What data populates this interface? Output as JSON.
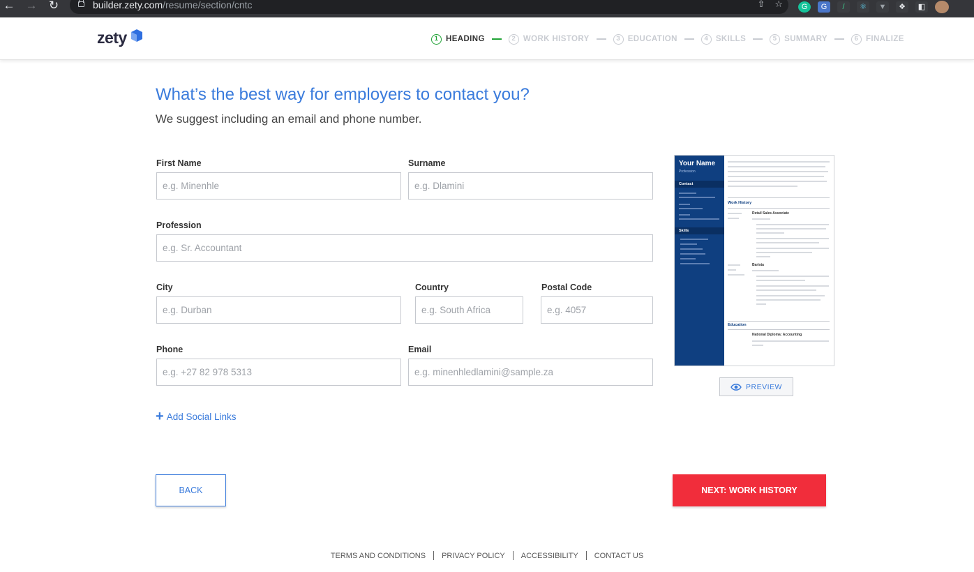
{
  "browser": {
    "url_host": "builder.zety.com",
    "url_path": "/resume/section/cntc"
  },
  "header": {
    "logo": "zety",
    "steps": [
      {
        "num": "1",
        "label": "HEADING"
      },
      {
        "num": "2",
        "label": "WORK HISTORY"
      },
      {
        "num": "3",
        "label": "EDUCATION"
      },
      {
        "num": "4",
        "label": "SKILLS"
      },
      {
        "num": "5",
        "label": "SUMMARY"
      },
      {
        "num": "6",
        "label": "FINALIZE"
      }
    ]
  },
  "main": {
    "title": "What’s the best way for employers to contact you?",
    "subtitle": "We suggest including an email and phone number."
  },
  "form": {
    "first_name": {
      "label": "First Name",
      "placeholder": "e.g. Minenhle"
    },
    "surname": {
      "label": "Surname",
      "placeholder": "e.g. Dlamini"
    },
    "profession": {
      "label": "Profession",
      "placeholder": "e.g. Sr. Accountant"
    },
    "city": {
      "label": "City",
      "placeholder": "e.g. Durban"
    },
    "country": {
      "label": "Country",
      "placeholder": "e.g. South Africa"
    },
    "postal_code": {
      "label": "Postal Code",
      "placeholder": "e.g. 4057"
    },
    "phone": {
      "label": "Phone",
      "placeholder": "e.g. +27 82 978 5313"
    },
    "email": {
      "label": "Email",
      "placeholder": "e.g. minenhledlamini@sample.za"
    },
    "add_social": "Add Social Links"
  },
  "buttons": {
    "back": "BACK",
    "next": "NEXT: WORK HISTORY",
    "preview": "PREVIEW"
  },
  "resume_preview": {
    "name": "Your Name",
    "profession": "Profession",
    "contact": "Contact",
    "skills": "Skills",
    "work_history": "Work History",
    "job1": "Retail Sales Associate",
    "job2": "Barista",
    "education": "Education",
    "degree": "National Diploma: Accounting"
  },
  "footer": {
    "links": [
      "TERMS AND CONDITIONS",
      "PRIVACY POLICY",
      "ACCESSIBILITY",
      "CONTACT US"
    ]
  },
  "colors": {
    "accent": "#3a7bdc",
    "cta": "#f12d3b",
    "success": "#21a336",
    "resume_sidebar": "#0f3f80"
  }
}
